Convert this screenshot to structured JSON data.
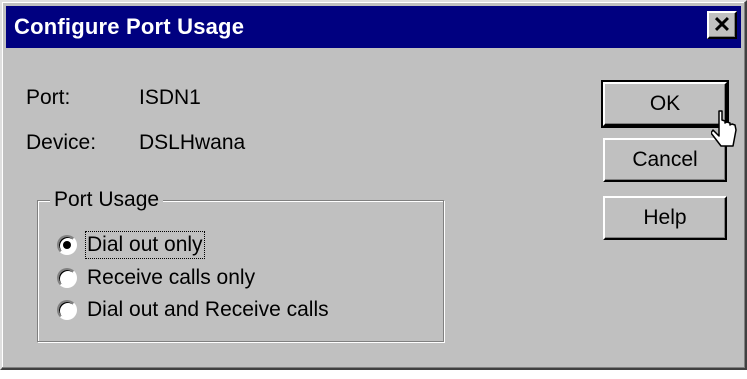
{
  "dialog": {
    "title": "Configure Port Usage",
    "close_symbol": "✕"
  },
  "info": {
    "port_label": "Port:",
    "port_value": "ISDN1",
    "device_label": "Device:",
    "device_value": "DSLHwana"
  },
  "buttons": {
    "ok": "OK",
    "cancel": "Cancel",
    "help": "Help"
  },
  "port_usage": {
    "legend": "Port Usage",
    "options": [
      {
        "label": "Dial out only",
        "checked": true
      },
      {
        "label": "Receive calls only",
        "checked": false
      },
      {
        "label": "Dial out and Receive calls",
        "checked": false
      }
    ]
  },
  "icons": {
    "cursor": "mouse-pointer-icon"
  },
  "colors": {
    "titlebar": "#000080",
    "face": "#c0c0c0"
  }
}
